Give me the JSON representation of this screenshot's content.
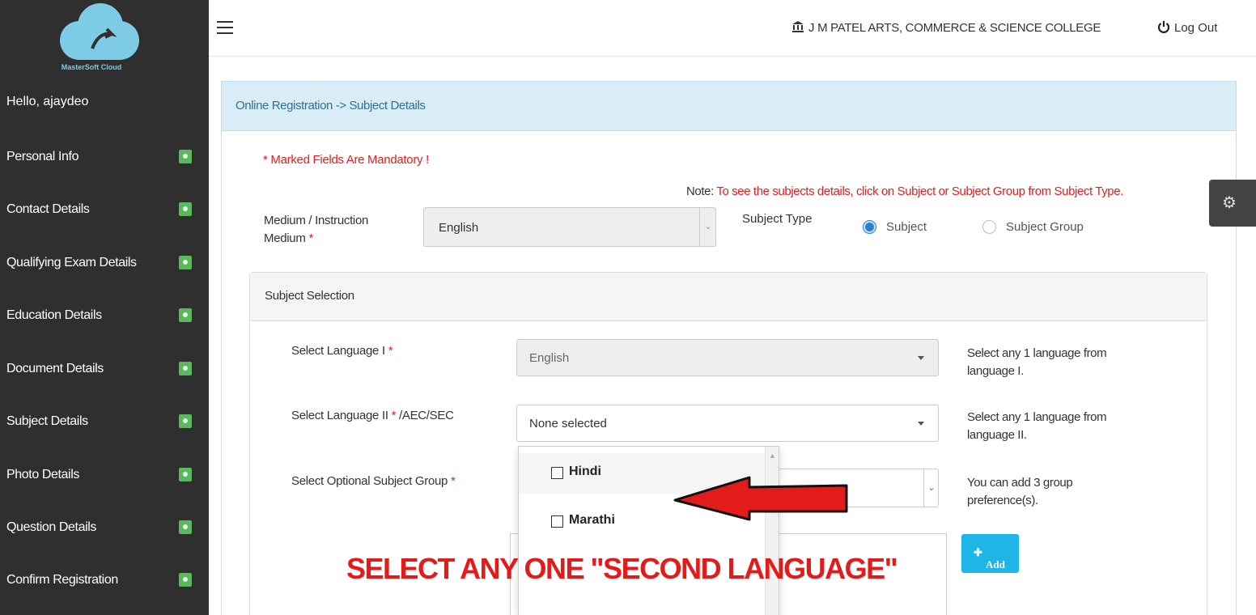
{
  "sidebar": {
    "logo_text": "MasterSoft Cloud",
    "greeting": "Hello, ajaydeo",
    "items": [
      {
        "label": "Personal Info"
      },
      {
        "label": "Contact Details"
      },
      {
        "label": "Qualifying Exam Details"
      },
      {
        "label": "Education Details"
      },
      {
        "label": "Document Details"
      },
      {
        "label": "Subject Details"
      },
      {
        "label": "Photo Details"
      },
      {
        "label": "Question Details"
      },
      {
        "label": "Confirm Registration"
      }
    ]
  },
  "topbar": {
    "college_name": "J M PATEL ARTS, COMMERCE & SCIENCE COLLEGE",
    "logout_label": "Log Out"
  },
  "panel": {
    "breadcrumb": "Online Registration -> Subject Details",
    "mandatory_note": "* Marked Fields Are Mandatory !",
    "note_label": "Note:",
    "note_text": "To see the subjects details, click on Subject or Subject Group from Subject Type."
  },
  "medium": {
    "label": "Medium / Instruction Medium",
    "required": "*",
    "value": "English"
  },
  "subject_type": {
    "label": "Subject Type",
    "options": [
      "Subject",
      "Subject Group"
    ],
    "selected": "Subject"
  },
  "subject_selection": {
    "title": "Subject Selection",
    "language1": {
      "label": "Select Language I",
      "required": "*",
      "value": "English",
      "hint": "Select any 1 language from language I."
    },
    "language2": {
      "label_prefix": "Select Language II",
      "required": "*",
      "label_suffix": "/AEC/SEC",
      "value": "None selected",
      "hint": "Select any 1 language from language II."
    },
    "optional_group": {
      "label": "Select Optional Subject Group",
      "required": "*",
      "hint": "You can add 3 group preference(s)."
    },
    "add_button": "Add"
  },
  "language2_dropdown": {
    "options": [
      {
        "label": "Hindi",
        "checked": false
      },
      {
        "label": "Marathi",
        "checked": false
      }
    ]
  },
  "annotation": "SELECT ANY ONE \"SECOND LANGUAGE\"",
  "colors": {
    "sidebar_bg": "#2f2f2f",
    "badge": "#5cb85c",
    "panel_head": "#d9edf7",
    "required": "#e02020",
    "add_button": "#1fb5e6",
    "annotation": "#e31b1b"
  }
}
